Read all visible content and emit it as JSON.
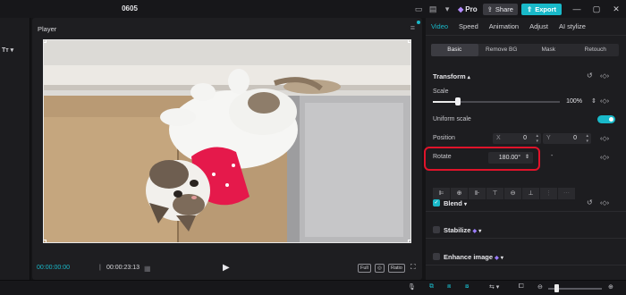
{
  "window": {
    "title": "0605",
    "pro_label": "Pro",
    "share_label": "Share",
    "export_label": "Export",
    "controls": [
      "—",
      "▢",
      "✕"
    ],
    "accent": "#19b9c9"
  },
  "left_panel": {
    "text_tool": "Tт ▾"
  },
  "player": {
    "label": "Player",
    "time_current": "00:00:00:00",
    "time_separator": "|",
    "time_total": "00:00:23:13",
    "controls": [
      "Full",
      "Ratio"
    ]
  },
  "right_panel": {
    "tabs": [
      "Video",
      "Speed",
      "Animation",
      "Adjust",
      "AI stylize"
    ],
    "active_tab": "Video",
    "subtabs": [
      "Basic",
      "Remove BG",
      "Mask",
      "Retouch"
    ],
    "active_subtab": "Basic",
    "transform": {
      "title": "Transform",
      "scale_label": "Scale",
      "scale_value": "100%",
      "scale_fraction": 0.2,
      "uniform_scale_label": "Uniform scale",
      "uniform_scale_on": true,
      "position_label": "Position",
      "x_axis": "X",
      "x_value": "0",
      "y_axis": "Y",
      "y_value": "0",
      "rotate_label": "Rotate",
      "rotate_value": "180.00°",
      "rotate_reset": "-"
    },
    "blend": {
      "title": "Blend",
      "checked": true
    },
    "stabilize": {
      "title": "Stabilize",
      "checked": false
    },
    "enhance": {
      "title": "Enhance image",
      "checked": false
    }
  }
}
